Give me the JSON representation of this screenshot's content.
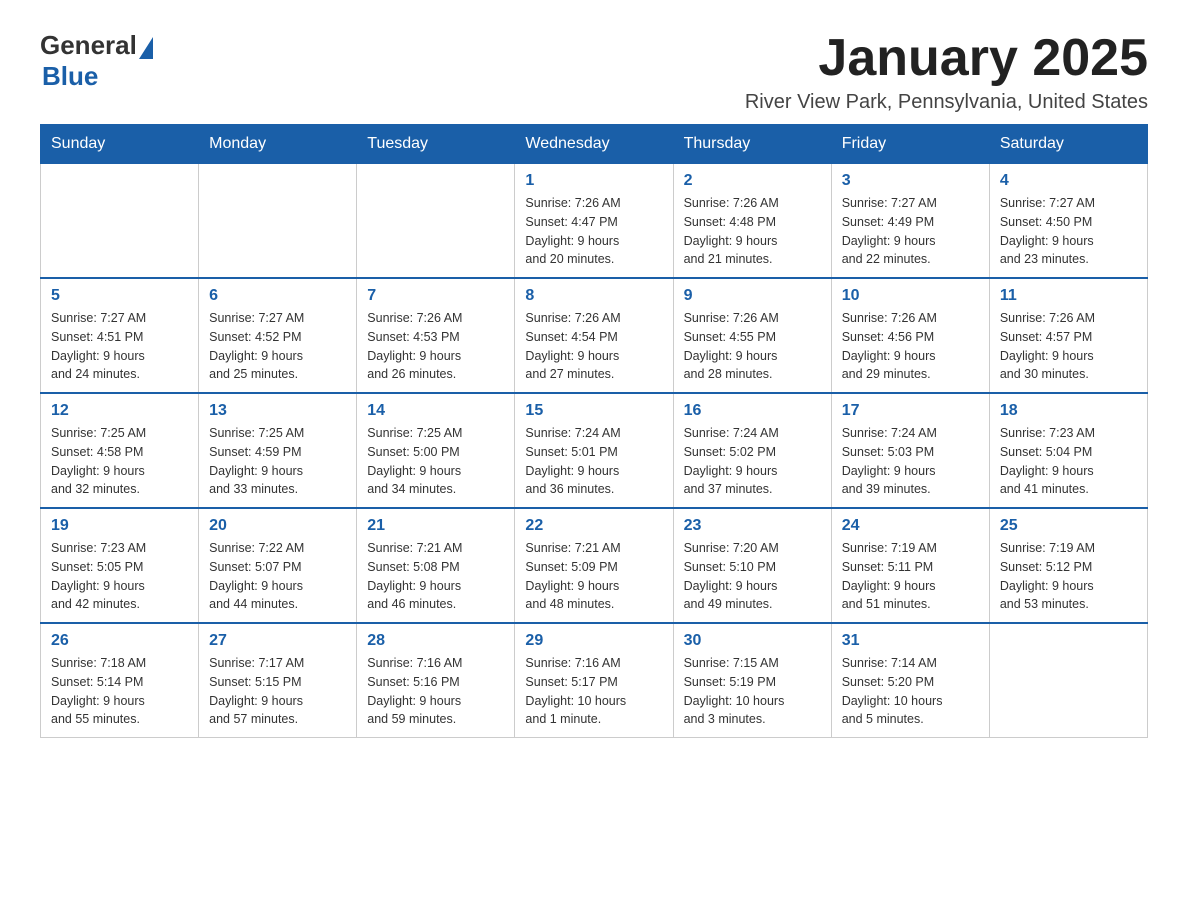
{
  "header": {
    "logo_general": "General",
    "logo_blue": "Blue",
    "month_title": "January 2025",
    "location": "River View Park, Pennsylvania, United States"
  },
  "days_of_week": [
    "Sunday",
    "Monday",
    "Tuesday",
    "Wednesday",
    "Thursday",
    "Friday",
    "Saturday"
  ],
  "weeks": [
    [
      {
        "day": "",
        "info": ""
      },
      {
        "day": "",
        "info": ""
      },
      {
        "day": "",
        "info": ""
      },
      {
        "day": "1",
        "info": "Sunrise: 7:26 AM\nSunset: 4:47 PM\nDaylight: 9 hours\nand 20 minutes."
      },
      {
        "day": "2",
        "info": "Sunrise: 7:26 AM\nSunset: 4:48 PM\nDaylight: 9 hours\nand 21 minutes."
      },
      {
        "day": "3",
        "info": "Sunrise: 7:27 AM\nSunset: 4:49 PM\nDaylight: 9 hours\nand 22 minutes."
      },
      {
        "day": "4",
        "info": "Sunrise: 7:27 AM\nSunset: 4:50 PM\nDaylight: 9 hours\nand 23 minutes."
      }
    ],
    [
      {
        "day": "5",
        "info": "Sunrise: 7:27 AM\nSunset: 4:51 PM\nDaylight: 9 hours\nand 24 minutes."
      },
      {
        "day": "6",
        "info": "Sunrise: 7:27 AM\nSunset: 4:52 PM\nDaylight: 9 hours\nand 25 minutes."
      },
      {
        "day": "7",
        "info": "Sunrise: 7:26 AM\nSunset: 4:53 PM\nDaylight: 9 hours\nand 26 minutes."
      },
      {
        "day": "8",
        "info": "Sunrise: 7:26 AM\nSunset: 4:54 PM\nDaylight: 9 hours\nand 27 minutes."
      },
      {
        "day": "9",
        "info": "Sunrise: 7:26 AM\nSunset: 4:55 PM\nDaylight: 9 hours\nand 28 minutes."
      },
      {
        "day": "10",
        "info": "Sunrise: 7:26 AM\nSunset: 4:56 PM\nDaylight: 9 hours\nand 29 minutes."
      },
      {
        "day": "11",
        "info": "Sunrise: 7:26 AM\nSunset: 4:57 PM\nDaylight: 9 hours\nand 30 minutes."
      }
    ],
    [
      {
        "day": "12",
        "info": "Sunrise: 7:25 AM\nSunset: 4:58 PM\nDaylight: 9 hours\nand 32 minutes."
      },
      {
        "day": "13",
        "info": "Sunrise: 7:25 AM\nSunset: 4:59 PM\nDaylight: 9 hours\nand 33 minutes."
      },
      {
        "day": "14",
        "info": "Sunrise: 7:25 AM\nSunset: 5:00 PM\nDaylight: 9 hours\nand 34 minutes."
      },
      {
        "day": "15",
        "info": "Sunrise: 7:24 AM\nSunset: 5:01 PM\nDaylight: 9 hours\nand 36 minutes."
      },
      {
        "day": "16",
        "info": "Sunrise: 7:24 AM\nSunset: 5:02 PM\nDaylight: 9 hours\nand 37 minutes."
      },
      {
        "day": "17",
        "info": "Sunrise: 7:24 AM\nSunset: 5:03 PM\nDaylight: 9 hours\nand 39 minutes."
      },
      {
        "day": "18",
        "info": "Sunrise: 7:23 AM\nSunset: 5:04 PM\nDaylight: 9 hours\nand 41 minutes."
      }
    ],
    [
      {
        "day": "19",
        "info": "Sunrise: 7:23 AM\nSunset: 5:05 PM\nDaylight: 9 hours\nand 42 minutes."
      },
      {
        "day": "20",
        "info": "Sunrise: 7:22 AM\nSunset: 5:07 PM\nDaylight: 9 hours\nand 44 minutes."
      },
      {
        "day": "21",
        "info": "Sunrise: 7:21 AM\nSunset: 5:08 PM\nDaylight: 9 hours\nand 46 minutes."
      },
      {
        "day": "22",
        "info": "Sunrise: 7:21 AM\nSunset: 5:09 PM\nDaylight: 9 hours\nand 48 minutes."
      },
      {
        "day": "23",
        "info": "Sunrise: 7:20 AM\nSunset: 5:10 PM\nDaylight: 9 hours\nand 49 minutes."
      },
      {
        "day": "24",
        "info": "Sunrise: 7:19 AM\nSunset: 5:11 PM\nDaylight: 9 hours\nand 51 minutes."
      },
      {
        "day": "25",
        "info": "Sunrise: 7:19 AM\nSunset: 5:12 PM\nDaylight: 9 hours\nand 53 minutes."
      }
    ],
    [
      {
        "day": "26",
        "info": "Sunrise: 7:18 AM\nSunset: 5:14 PM\nDaylight: 9 hours\nand 55 minutes."
      },
      {
        "day": "27",
        "info": "Sunrise: 7:17 AM\nSunset: 5:15 PM\nDaylight: 9 hours\nand 57 minutes."
      },
      {
        "day": "28",
        "info": "Sunrise: 7:16 AM\nSunset: 5:16 PM\nDaylight: 9 hours\nand 59 minutes."
      },
      {
        "day": "29",
        "info": "Sunrise: 7:16 AM\nSunset: 5:17 PM\nDaylight: 10 hours\nand 1 minute."
      },
      {
        "day": "30",
        "info": "Sunrise: 7:15 AM\nSunset: 5:19 PM\nDaylight: 10 hours\nand 3 minutes."
      },
      {
        "day": "31",
        "info": "Sunrise: 7:14 AM\nSunset: 5:20 PM\nDaylight: 10 hours\nand 5 minutes."
      },
      {
        "day": "",
        "info": ""
      }
    ]
  ]
}
